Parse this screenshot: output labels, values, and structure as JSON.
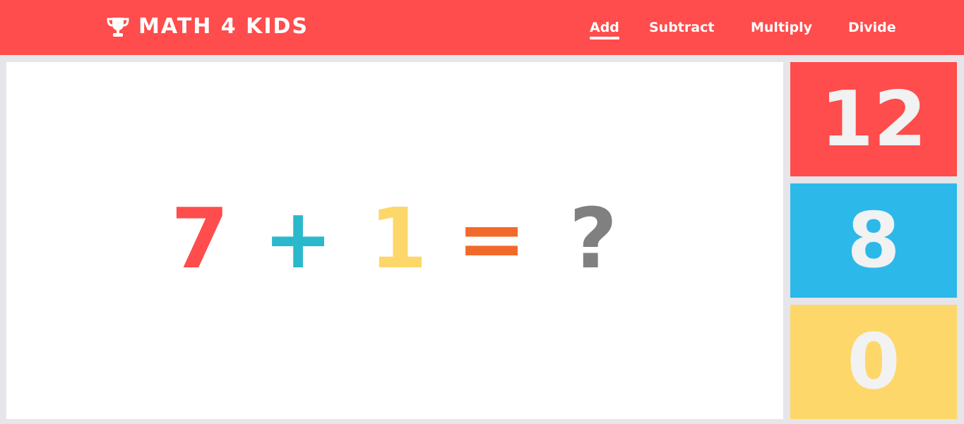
{
  "header": {
    "brand_title": "MATH 4 KIDS",
    "brand_icon": "trophy-icon",
    "nav": [
      {
        "label": "Add",
        "active": true
      },
      {
        "label": "Subtract",
        "active": false
      },
      {
        "label": "Multiply",
        "active": false
      },
      {
        "label": "Divide",
        "active": false
      }
    ]
  },
  "problem": {
    "operand_a": "7",
    "operator": "+",
    "operand_b": "1",
    "equals": "=",
    "unknown": "?"
  },
  "answers": [
    {
      "label": "12",
      "color": "#ff4c4c"
    },
    {
      "label": "8",
      "color": "#2cb9ea"
    },
    {
      "label": "0",
      "color": "#fdd76a"
    }
  ],
  "colors": {
    "header_bg": "#ff4c4c",
    "operand_a": "#ff4c4c",
    "operator": "#2ab8cc",
    "operand_b": "#fdd76a",
    "equals": "#f26a2b",
    "unknown": "#808080"
  }
}
